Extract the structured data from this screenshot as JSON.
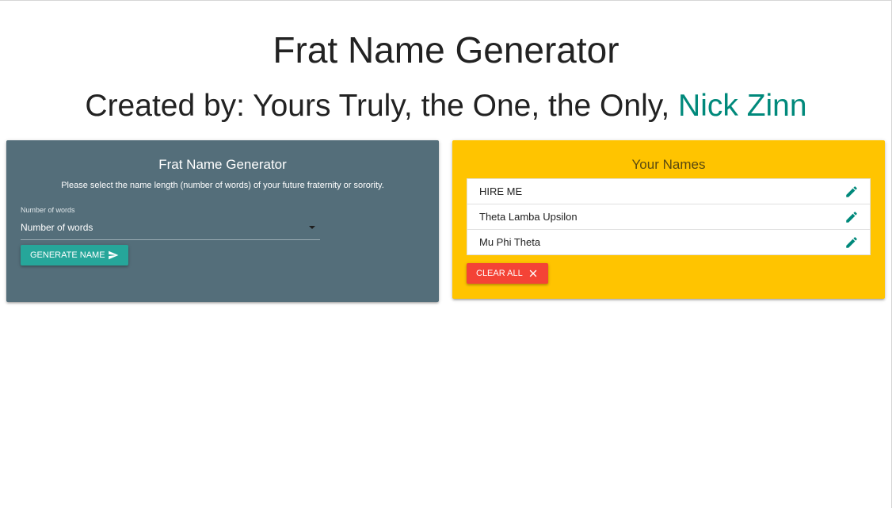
{
  "header": {
    "title": "Frat Name Generator",
    "subtitle_prefix": "Created by: Yours Truly, the One, the Only, ",
    "subtitle_author": "Nick Zinn"
  },
  "generator_card": {
    "title": "Frat Name Generator",
    "instructions": "Please select the name length (number of words) of your future fraternity or sorority.",
    "select": {
      "label": "Number of words",
      "selected": "Number of words",
      "icon": "caret-down-icon"
    },
    "generate_button": {
      "label": "Generate Name",
      "icon": "send-icon"
    },
    "background_color": "#546e7a",
    "button_color": "#26a69a"
  },
  "names_card": {
    "title": "Your Names",
    "items": [
      {
        "label": "HIRE ME",
        "icon": "edit-icon"
      },
      {
        "label": "Theta Lamba Upsilon",
        "icon": "edit-icon"
      },
      {
        "label": "Mu Phi Theta",
        "icon": "edit-icon"
      }
    ],
    "clear_button": {
      "label": "Clear All",
      "icon": "close-icon"
    },
    "background_color": "#ffc400",
    "button_color": "#f44336",
    "icon_color": "#00897b"
  }
}
